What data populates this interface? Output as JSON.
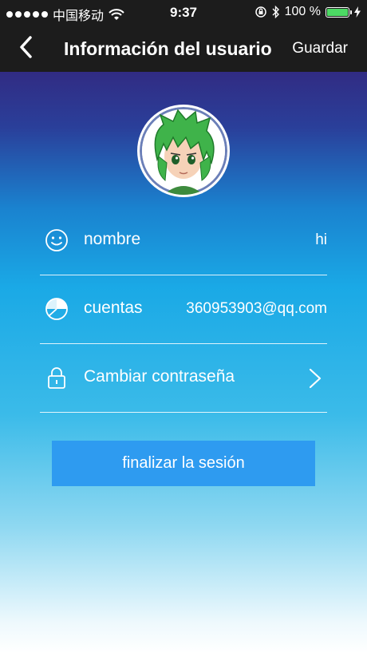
{
  "status_bar": {
    "carrier": "中国移动",
    "time": "9:37",
    "battery": "100 %",
    "battery_level": 1.0,
    "battery_color": "#4cd964"
  },
  "header": {
    "title": "Información del usuario",
    "save_label": "Guardar",
    "back_icon": "chevron-left-icon"
  },
  "profile": {
    "avatar_icon": "anime-avatar-green-hair"
  },
  "rows": {
    "name": {
      "label": "nombre",
      "value": "hi",
      "icon": "smiley-icon"
    },
    "account": {
      "label": "cuentas",
      "value": "360953903@qq.com",
      "icon": "pie-chart-icon"
    },
    "password": {
      "label": "Cambiar contraseña",
      "icon": "lock-icon",
      "chevron_icon": "chevron-right-icon"
    }
  },
  "logout_button": {
    "label": "finalizar la sesión",
    "color": "#2e9bf0"
  }
}
